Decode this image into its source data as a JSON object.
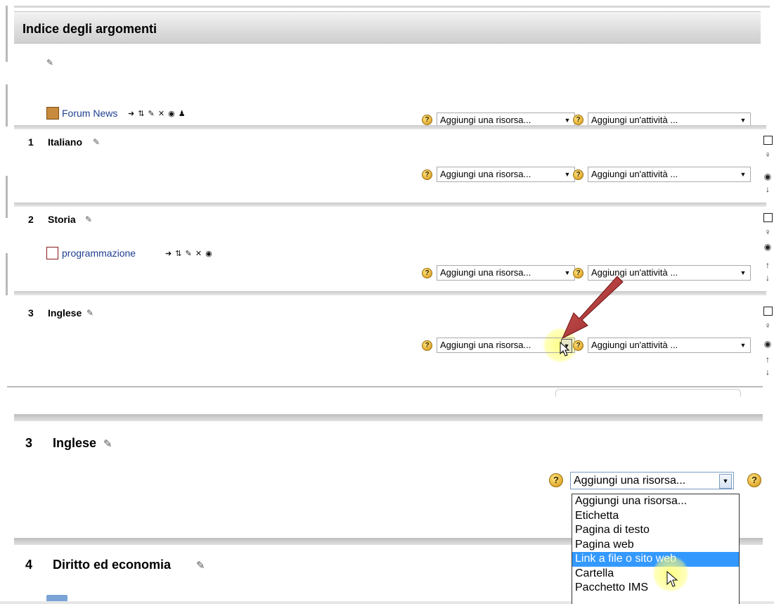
{
  "header": {
    "title": "Indice degli argomenti"
  },
  "controls": {
    "add_resource": "Aggiungi una risorsa...",
    "add_activity": "Aggiungi un'attività ..."
  },
  "sections": [
    {
      "number": "",
      "title": "",
      "items": [
        {
          "label": "Forum News",
          "icon": "forum-icon"
        }
      ]
    },
    {
      "number": "1",
      "title": "Italiano",
      "items": []
    },
    {
      "number": "2",
      "title": "Storia",
      "items": [
        {
          "label": "programmazione",
          "icon": "pdf-icon"
        }
      ]
    },
    {
      "number": "3",
      "title": "Inglese",
      "items": []
    }
  ],
  "zoom": {
    "section3": {
      "number": "3",
      "title": "Inglese"
    },
    "section4": {
      "number": "4",
      "title": "Diritto ed economia"
    },
    "select_value": "Aggiungi una risorsa...",
    "dropdown_options": [
      "Aggiungi una risorsa...",
      "Etichetta",
      "Pagina di testo",
      "Pagina web",
      "Link a file o sito web",
      "Cartella",
      "Pacchetto IMS"
    ],
    "selected_index": 4
  },
  "colors": {
    "link": "#1e3f8f",
    "dropdown_selected": "#3399ff",
    "arrow": "#b03030",
    "highlight": "#ffff78"
  },
  "icons": [
    "pencil-icon",
    "move-right-icon",
    "move-updown-icon",
    "edit-icon",
    "delete-icon",
    "eye-icon",
    "assign-roles-icon",
    "help-icon",
    "chevron-down-icon",
    "checkbox-icon",
    "bulb-icon",
    "arrow-up-icon",
    "arrow-down-icon",
    "mouse-cursor-icon"
  ]
}
